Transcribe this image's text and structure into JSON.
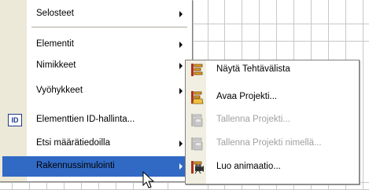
{
  "menu": {
    "items": [
      {
        "label": "Selosteet",
        "submenu": true
      },
      {
        "label": "Elementit",
        "submenu": true
      },
      {
        "label": "Nimikkeet",
        "submenu": true
      },
      {
        "label": "Vyöhykkeet",
        "submenu": true
      },
      {
        "label": "Elementtien ID-hallinta...",
        "submenu": false,
        "icon": "id-icon"
      },
      {
        "label": "Etsi määrätiedoilla",
        "submenu": true
      },
      {
        "label": "Rakennussimulointi",
        "submenu": true,
        "selected": true
      }
    ]
  },
  "submenu": {
    "items": [
      {
        "label": "Näytä Tehtävälista",
        "icon": "task-list-icon",
        "enabled": true
      },
      {
        "label": "Avaa Projekti...",
        "icon": "open-project-icon",
        "enabled": true
      },
      {
        "label": "Tallenna Projekti...",
        "icon": "save-project-icon",
        "enabled": false
      },
      {
        "label": "Tallenna Projekti nimellä...",
        "icon": "save-project-as-icon",
        "enabled": false
      },
      {
        "label": "Luo animaatio...",
        "icon": "create-animation-icon",
        "enabled": true
      }
    ]
  },
  "colors": {
    "selection": "#316ac5",
    "gutter": "#ece9d8",
    "disabled_text": "#a0a0a0"
  }
}
